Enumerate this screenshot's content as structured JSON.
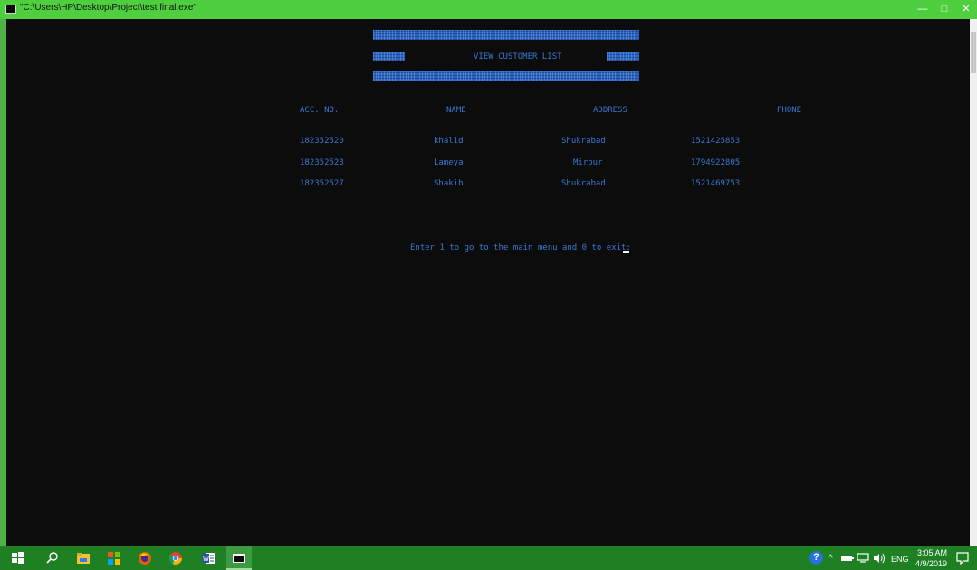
{
  "window": {
    "title": "\"C:\\Users\\HP\\Desktop\\Project\\test final.exe\"",
    "minimize_glyph": "—",
    "maximize_glyph": "□",
    "close_glyph": "✕"
  },
  "console": {
    "heading": "VIEW CUSTOMER LIST",
    "columns": [
      "ACC. NO.",
      "NAME",
      "ADDRESS",
      "PHONE"
    ],
    "rows": [
      {
        "acc": "182352520",
        "name": "khalid",
        "address": "Shukrabad",
        "phone": "1521425853"
      },
      {
        "acc": "182352523",
        "name": "Lameya",
        "address": "Mirpur",
        "phone": "1794922805"
      },
      {
        "acc": "182352527",
        "name": "Shakib",
        "address": "Shukrabad",
        "phone": "1521469753"
      }
    ],
    "prompt": "Enter 1 to go to the main menu and 0 to exit:"
  },
  "taskbar": {
    "icons": [
      "start-icon",
      "search-icon",
      "file-explorer-icon",
      "store-icon",
      "firefox-icon",
      "chrome-icon",
      "word-icon",
      "console-app-icon"
    ],
    "tray": {
      "help_glyph": "?",
      "chevron_glyph": "^",
      "language": "ENG",
      "time": "3:05 AM",
      "date": "4/9/2019"
    }
  },
  "colors": {
    "console_bg": "#0c0c0c",
    "console_text": "#3a78d4",
    "titlebar": "#4fcf3f",
    "taskbar": "#1e7f23"
  }
}
